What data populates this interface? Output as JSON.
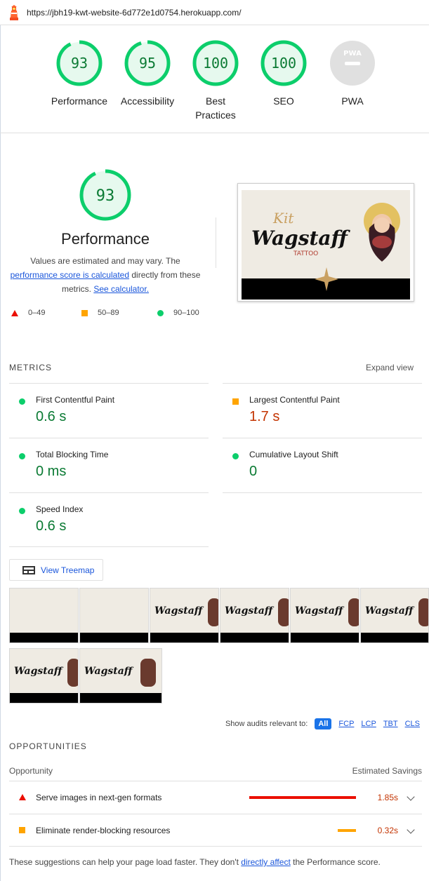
{
  "url": "https://jbh19-kwt-website-6d772e1d0754.herokuapp.com/",
  "gauges": [
    {
      "score": "93",
      "label": "Performance",
      "fraction": 0.93
    },
    {
      "score": "95",
      "label": "Accessibility",
      "fraction": 0.95
    },
    {
      "score": "100",
      "label": "Best Practices",
      "fraction": 1.0
    },
    {
      "score": "100",
      "label": "SEO",
      "fraction": 1.0
    },
    {
      "score": "PWA",
      "label": "PWA",
      "fraction": 0
    }
  ],
  "performance": {
    "score": "93",
    "fraction": 0.93,
    "title": "Performance",
    "desc_1": "Values are estimated and may vary. The",
    "link_score": "performance score is calculated",
    "desc_2": "directly from these",
    "desc_3": "metrics.",
    "link_calc": "See calculator."
  },
  "legend": {
    "poor": "0–49",
    "average": "50–89",
    "good": "90–100"
  },
  "screenshot": {
    "kit": "Kit",
    "wagstaff": "Wagstaff",
    "tattoo": "TATTOO"
  },
  "metrics_section": {
    "title": "METRICS",
    "expand": "Expand view"
  },
  "metrics": [
    {
      "name": "First Contentful Paint",
      "value": "0.6 s",
      "status": "good"
    },
    {
      "name": "Largest Contentful Paint",
      "value": "1.7 s",
      "status": "average"
    },
    {
      "name": "Total Blocking Time",
      "value": "0 ms",
      "status": "good"
    },
    {
      "name": "Cumulative Layout Shift",
      "value": "0",
      "status": "good"
    },
    {
      "name": "Speed Index",
      "value": "0.6 s",
      "status": "good"
    }
  ],
  "treemap": {
    "label": "View Treemap"
  },
  "audits_filter": {
    "label": "Show audits relevant to:",
    "chips": [
      "All",
      "FCP",
      "LCP",
      "TBT",
      "CLS"
    ]
  },
  "opportunities": {
    "title": "OPPORTUNITIES",
    "col_left": "Opportunity",
    "col_right": "Estimated Savings",
    "items": [
      {
        "name": "Serve images in next-gen formats",
        "savings": "1.85s",
        "status": "poor",
        "fraction": 1.0
      },
      {
        "name": "Eliminate render-blocking resources",
        "savings": "0.32s",
        "status": "average",
        "fraction": 0.17
      }
    ]
  },
  "footer": {
    "text_1": "These suggestions can help your page load faster. They don't",
    "link": "directly affect",
    "text_2": "the Performance score."
  },
  "colors": {
    "good": "#0cce6b",
    "average": "#ffa400",
    "poor": "#eb0f00",
    "link": "#1a56db"
  }
}
